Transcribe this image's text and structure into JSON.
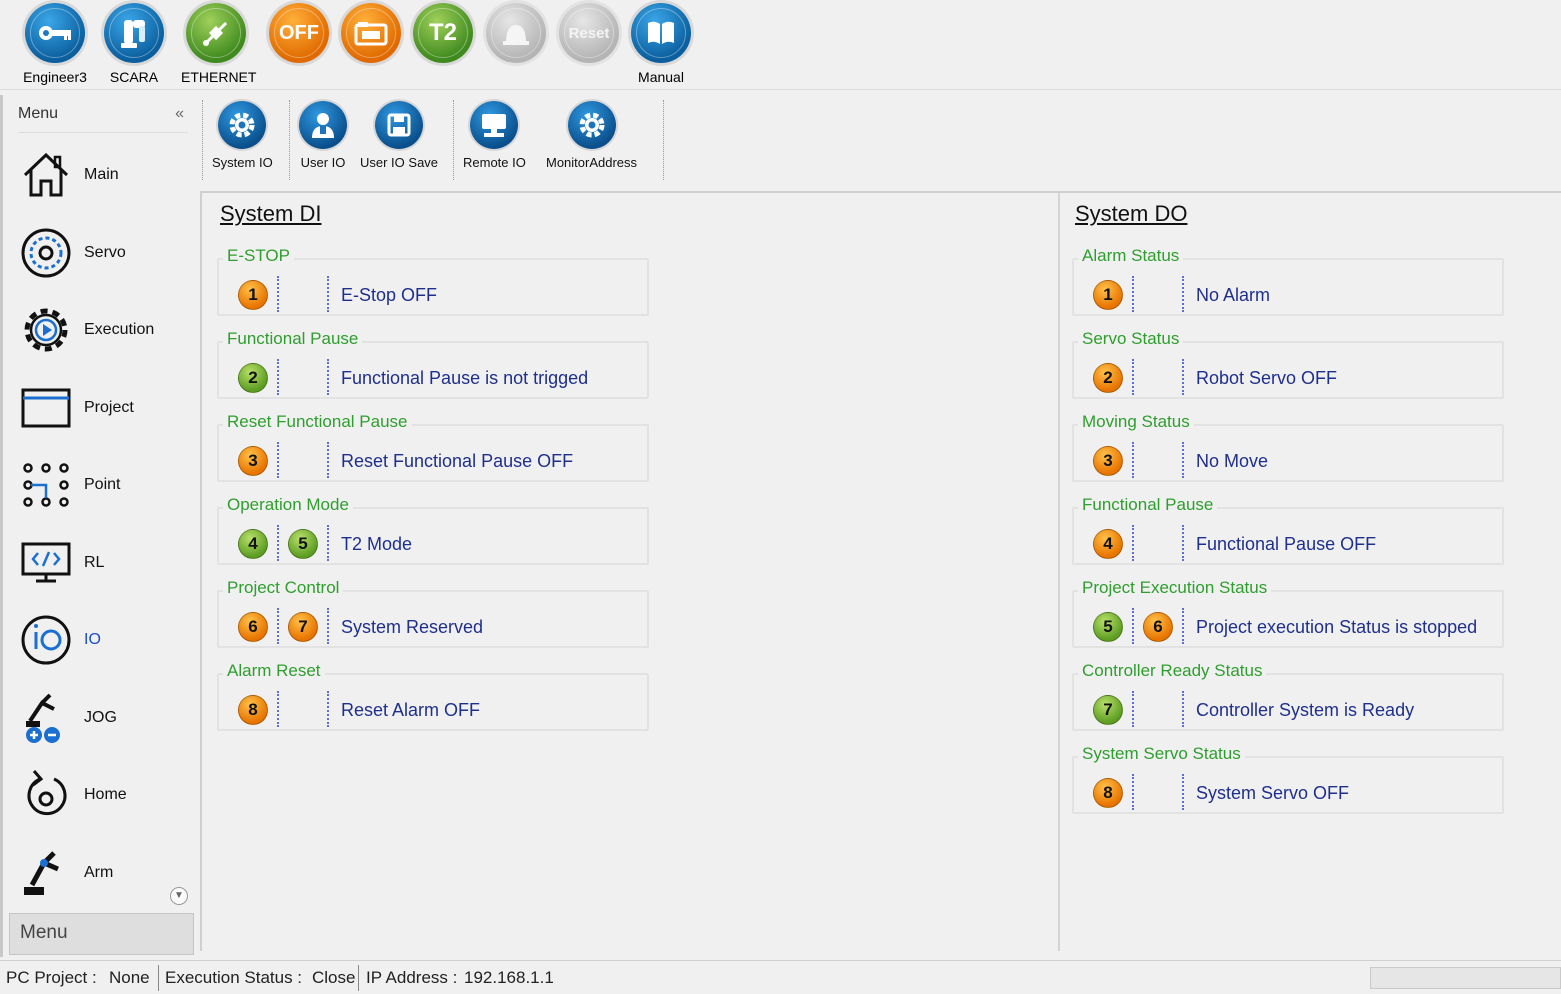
{
  "toolbar": {
    "buttons": [
      {
        "label": "Engineer3",
        "icon": "key-icon",
        "color": "#0b5f9e"
      },
      {
        "label": "SCARA",
        "icon": "robot-arm-icon",
        "color": "#0b5f9e"
      },
      {
        "label": "ETHERNET",
        "icon": "ethernet-plug-icon",
        "color": "#3f8a1e"
      },
      {
        "label": "",
        "icon": "off-icon",
        "text": "OFF",
        "color": "#e06a00"
      },
      {
        "label": "",
        "icon": "folder-icon",
        "color": "#e06a00"
      },
      {
        "label": "",
        "icon": "t2-icon",
        "text": "T2",
        "color": "#3f8a1e"
      },
      {
        "label": "",
        "icon": "robot-disabled-icon",
        "color": "#b4b4b4"
      },
      {
        "label": "",
        "icon": "reset-icon",
        "text": "Reset",
        "color": "#b4b4b4"
      },
      {
        "label": "Manual",
        "icon": "book-icon",
        "color": "#0b5f9e"
      }
    ]
  },
  "menu": {
    "header": "Menu",
    "collapse": "«",
    "footer": "Menu",
    "items": [
      {
        "label": "Main",
        "icon": "home-icon"
      },
      {
        "label": "Servo",
        "icon": "servo-icon"
      },
      {
        "label": "Execution",
        "icon": "execution-gear-icon"
      },
      {
        "label": "Project",
        "icon": "project-folder-icon"
      },
      {
        "label": "Point",
        "icon": "point-icon"
      },
      {
        "label": "RL",
        "icon": "code-monitor-icon"
      },
      {
        "label": "IO",
        "icon": "io-icon",
        "active": true
      },
      {
        "label": "JOG",
        "icon": "jog-icon"
      },
      {
        "label": "Home",
        "icon": "home-return-icon"
      },
      {
        "label": "Arm",
        "icon": "arm-icon"
      }
    ]
  },
  "subtoolbar": {
    "buttons": [
      {
        "label": "System IO",
        "icon": "gear-icon"
      },
      {
        "label": "User IO",
        "icon": "user-icon"
      },
      {
        "label": "User IO Save",
        "icon": "save-icon"
      },
      {
        "label": "Remote IO",
        "icon": "remote-monitor-icon"
      },
      {
        "label": "MonitorAddress",
        "icon": "gear-icon"
      }
    ]
  },
  "system_di": {
    "title": "System DI",
    "groups": [
      {
        "legend": "E-STOP",
        "dots": [
          {
            "n": "1",
            "color": "orange"
          }
        ],
        "text": "E-Stop OFF"
      },
      {
        "legend": "Functional Pause",
        "dots": [
          {
            "n": "2",
            "color": "green"
          }
        ],
        "text": "Functional Pause is not trigged"
      },
      {
        "legend": "Reset Functional Pause",
        "dots": [
          {
            "n": "3",
            "color": "orange"
          }
        ],
        "text": "Reset Functional Pause OFF"
      },
      {
        "legend": "Operation Mode",
        "dots": [
          {
            "n": "4",
            "color": "green"
          },
          {
            "n": "5",
            "color": "green"
          }
        ],
        "text": "T2 Mode"
      },
      {
        "legend": "Project Control",
        "dots": [
          {
            "n": "6",
            "color": "orange"
          },
          {
            "n": "7",
            "color": "orange"
          }
        ],
        "text": "System Reserved"
      },
      {
        "legend": "Alarm Reset",
        "dots": [
          {
            "n": "8",
            "color": "orange"
          }
        ],
        "text": "Reset Alarm OFF"
      }
    ]
  },
  "system_do": {
    "title": "System DO",
    "groups": [
      {
        "legend": "Alarm Status",
        "dots": [
          {
            "n": "1",
            "color": "orange"
          }
        ],
        "text": "No Alarm"
      },
      {
        "legend": "Servo Status",
        "dots": [
          {
            "n": "2",
            "color": "orange"
          }
        ],
        "text": "Robot Servo OFF"
      },
      {
        "legend": "Moving Status",
        "dots": [
          {
            "n": "3",
            "color": "orange"
          }
        ],
        "text": "No Move"
      },
      {
        "legend": "Functional Pause",
        "dots": [
          {
            "n": "4",
            "color": "orange"
          }
        ],
        "text": "Functional Pause OFF"
      },
      {
        "legend": "Project Execution Status",
        "dots": [
          {
            "n": "5",
            "color": "green"
          },
          {
            "n": "6",
            "color": "orange"
          }
        ],
        "text": "Project execution Status is stopped"
      },
      {
        "legend": "Controller Ready Status",
        "dots": [
          {
            "n": "7",
            "color": "green"
          }
        ],
        "text": "Controller System is Ready"
      },
      {
        "legend": "System Servo Status",
        "dots": [
          {
            "n": "8",
            "color": "orange"
          }
        ],
        "text": "System Servo OFF"
      }
    ]
  },
  "status": {
    "pc_project_label": "PC Project :",
    "pc_project_value": "None",
    "execution_label": "Execution Status :",
    "execution_value": "Close",
    "ip_label": "IP Address :",
    "ip_value": "192.168.1.1"
  },
  "colors": {
    "legend_green": "#2e9e2e",
    "status_text_blue": "#1f2f8c",
    "led_orange": "#e87400",
    "led_green": "#5e9e23",
    "accent_blue": "#0b5f9e"
  }
}
